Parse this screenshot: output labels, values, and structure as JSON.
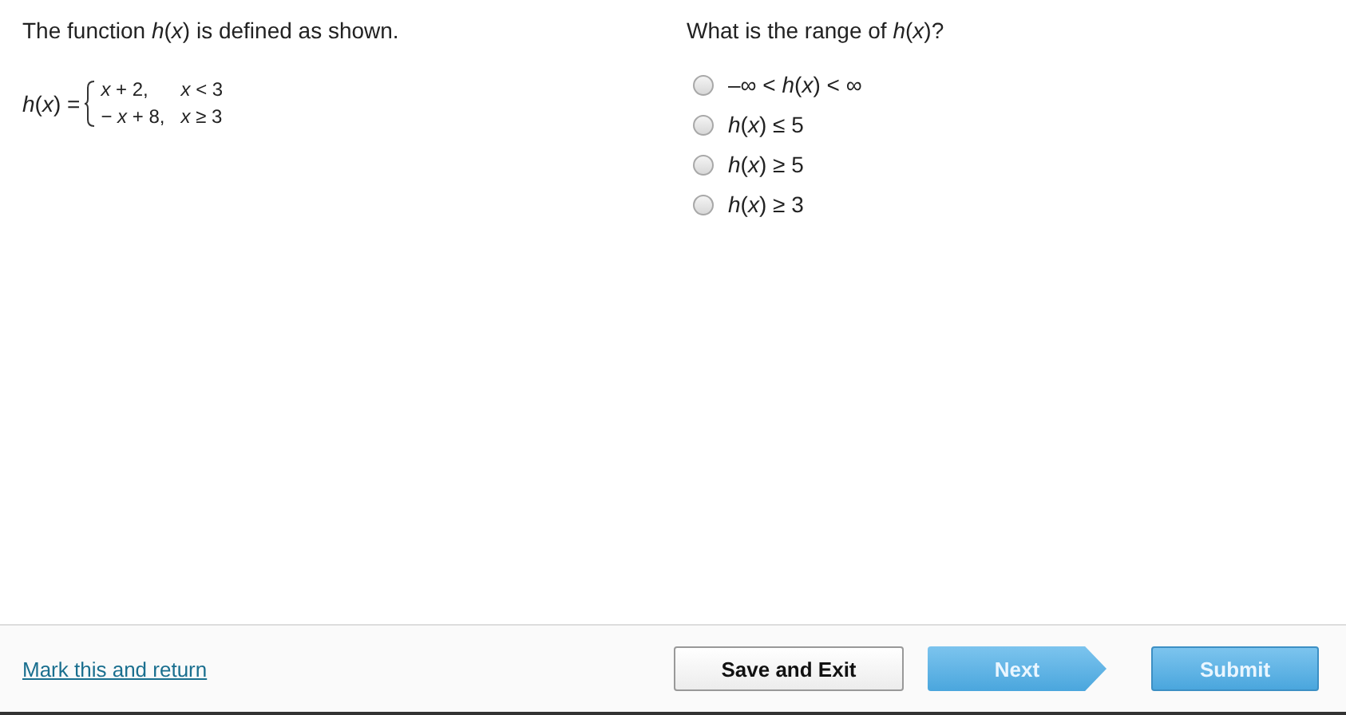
{
  "question": {
    "stem": "The function *h*(*x*) is defined as shown.",
    "function_name": "*h*(*x*) =",
    "cases": [
      {
        "expression": "*x* + 2,",
        "condition": "*x* < 3"
      },
      {
        "expression": "− *x* + 8,",
        "condition": "*x* ≥ 3"
      }
    ]
  },
  "answer": {
    "prompt": "What is the range of *h*(*x*)?",
    "options": [
      {
        "label": "–∞ < *h*(*x*) < ∞",
        "selected": false
      },
      {
        "label": "*h*(*x*) ≤ 5",
        "selected": false
      },
      {
        "label": "*h*(*x*) ≥ 5",
        "selected": false
      },
      {
        "label": "*h*(*x*) ≥ 3",
        "selected": false
      }
    ]
  },
  "footer": {
    "link": "Mark this and return",
    "buttons": [
      {
        "kind": "secondary",
        "label": "Save and Exit"
      },
      {
        "kind": "next",
        "label": "Next"
      },
      {
        "kind": "primary",
        "label": "Submit"
      }
    ]
  }
}
